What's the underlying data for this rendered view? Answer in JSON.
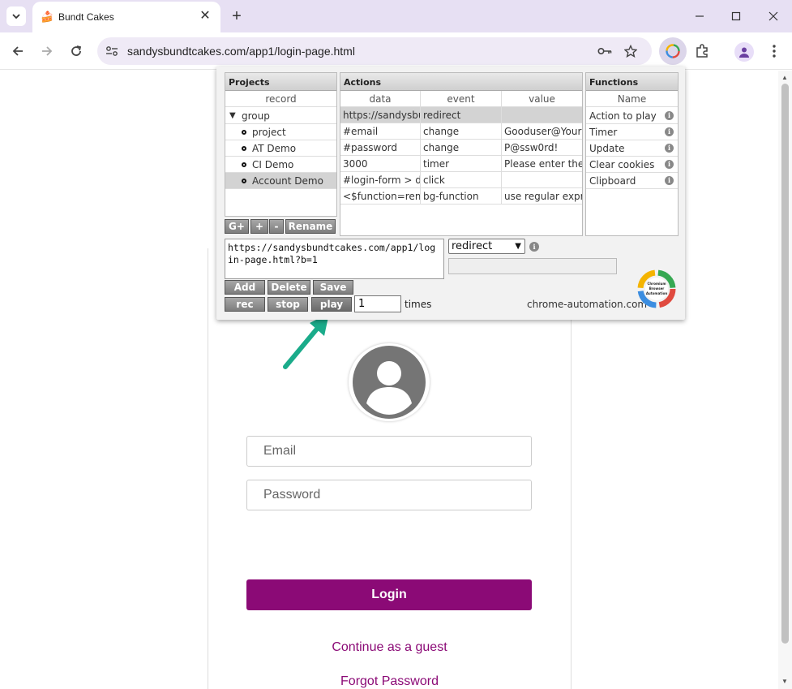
{
  "browser": {
    "tab_title": "Bundt Cakes",
    "url": "sandysbundtcakes.com/app1/login-page.html"
  },
  "page": {
    "email_placeholder": "Email",
    "password_placeholder": "Password",
    "login_label": "Login",
    "guest_link": "Continue as a guest",
    "forgot_link": "Forgot Password"
  },
  "popup": {
    "projects": {
      "title": "Projects",
      "column": "record",
      "items": [
        {
          "label": "group",
          "type": "group"
        },
        {
          "label": "project",
          "type": "item"
        },
        {
          "label": "AT Demo",
          "type": "item"
        },
        {
          "label": "CI Demo",
          "type": "item"
        },
        {
          "label": "Account Demo",
          "type": "item",
          "selected": true
        }
      ],
      "buttons": [
        "G+",
        "+",
        "-",
        "Rename"
      ]
    },
    "actions": {
      "title": "Actions",
      "columns": [
        "data",
        "event",
        "value"
      ],
      "rows": [
        {
          "data": "https://sandysbundtcakes.com/app1/login-page.html?b=1",
          "event": "redirect",
          "value": "",
          "selected": true
        },
        {
          "data": "#email",
          "event": "change",
          "value": "Gooduser@YourCompany.com"
        },
        {
          "data": "#password",
          "event": "change",
          "value": "P@ssw0rd!"
        },
        {
          "data": "3000",
          "event": "timer",
          "value": "Please enter the"
        },
        {
          "data": "#login-form > div",
          "event": "click",
          "value": ""
        },
        {
          "data": "<$function=removeCookies>",
          "event": "bg-function",
          "value": "use regular expression"
        }
      ]
    },
    "functions": {
      "title": "Functions",
      "column": "Name",
      "items": [
        "Action to play",
        "Timer",
        "Update",
        "Clear cookies",
        "Clipboard"
      ]
    },
    "editor_value": "https://sandysbundtcakes.com/app1/login-page.html?b=1",
    "event_select": "redirect",
    "buttons_row1": [
      "Add",
      "Delete",
      "Save"
    ],
    "buttons_row2": [
      "rec",
      "stop",
      "play"
    ],
    "times_value": "1",
    "times_label": "times",
    "site_label": "chrome-automation.com",
    "logo_text": [
      "Chromium",
      "Browser",
      "Automation"
    ]
  },
  "colors": {
    "brand_purple": "#8b0a76",
    "annotation_arrow": "#1aab8a"
  }
}
